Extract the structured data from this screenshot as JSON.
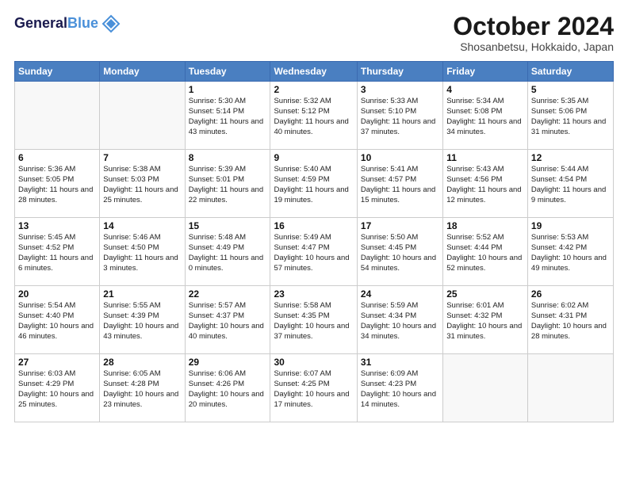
{
  "header": {
    "logo_line1": "General",
    "logo_line2": "Blue",
    "month": "October 2024",
    "location": "Shosanbetsu, Hokkaido, Japan"
  },
  "days_of_week": [
    "Sunday",
    "Monday",
    "Tuesday",
    "Wednesday",
    "Thursday",
    "Friday",
    "Saturday"
  ],
  "weeks": [
    [
      {
        "day": "",
        "info": ""
      },
      {
        "day": "",
        "info": ""
      },
      {
        "day": "1",
        "info": "Sunrise: 5:30 AM\nSunset: 5:14 PM\nDaylight: 11 hours and 43 minutes."
      },
      {
        "day": "2",
        "info": "Sunrise: 5:32 AM\nSunset: 5:12 PM\nDaylight: 11 hours and 40 minutes."
      },
      {
        "day": "3",
        "info": "Sunrise: 5:33 AM\nSunset: 5:10 PM\nDaylight: 11 hours and 37 minutes."
      },
      {
        "day": "4",
        "info": "Sunrise: 5:34 AM\nSunset: 5:08 PM\nDaylight: 11 hours and 34 minutes."
      },
      {
        "day": "5",
        "info": "Sunrise: 5:35 AM\nSunset: 5:06 PM\nDaylight: 11 hours and 31 minutes."
      }
    ],
    [
      {
        "day": "6",
        "info": "Sunrise: 5:36 AM\nSunset: 5:05 PM\nDaylight: 11 hours and 28 minutes."
      },
      {
        "day": "7",
        "info": "Sunrise: 5:38 AM\nSunset: 5:03 PM\nDaylight: 11 hours and 25 minutes."
      },
      {
        "day": "8",
        "info": "Sunrise: 5:39 AM\nSunset: 5:01 PM\nDaylight: 11 hours and 22 minutes."
      },
      {
        "day": "9",
        "info": "Sunrise: 5:40 AM\nSunset: 4:59 PM\nDaylight: 11 hours and 19 minutes."
      },
      {
        "day": "10",
        "info": "Sunrise: 5:41 AM\nSunset: 4:57 PM\nDaylight: 11 hours and 15 minutes."
      },
      {
        "day": "11",
        "info": "Sunrise: 5:43 AM\nSunset: 4:56 PM\nDaylight: 11 hours and 12 minutes."
      },
      {
        "day": "12",
        "info": "Sunrise: 5:44 AM\nSunset: 4:54 PM\nDaylight: 11 hours and 9 minutes."
      }
    ],
    [
      {
        "day": "13",
        "info": "Sunrise: 5:45 AM\nSunset: 4:52 PM\nDaylight: 11 hours and 6 minutes."
      },
      {
        "day": "14",
        "info": "Sunrise: 5:46 AM\nSunset: 4:50 PM\nDaylight: 11 hours and 3 minutes."
      },
      {
        "day": "15",
        "info": "Sunrise: 5:48 AM\nSunset: 4:49 PM\nDaylight: 11 hours and 0 minutes."
      },
      {
        "day": "16",
        "info": "Sunrise: 5:49 AM\nSunset: 4:47 PM\nDaylight: 10 hours and 57 minutes."
      },
      {
        "day": "17",
        "info": "Sunrise: 5:50 AM\nSunset: 4:45 PM\nDaylight: 10 hours and 54 minutes."
      },
      {
        "day": "18",
        "info": "Sunrise: 5:52 AM\nSunset: 4:44 PM\nDaylight: 10 hours and 52 minutes."
      },
      {
        "day": "19",
        "info": "Sunrise: 5:53 AM\nSunset: 4:42 PM\nDaylight: 10 hours and 49 minutes."
      }
    ],
    [
      {
        "day": "20",
        "info": "Sunrise: 5:54 AM\nSunset: 4:40 PM\nDaylight: 10 hours and 46 minutes."
      },
      {
        "day": "21",
        "info": "Sunrise: 5:55 AM\nSunset: 4:39 PM\nDaylight: 10 hours and 43 minutes."
      },
      {
        "day": "22",
        "info": "Sunrise: 5:57 AM\nSunset: 4:37 PM\nDaylight: 10 hours and 40 minutes."
      },
      {
        "day": "23",
        "info": "Sunrise: 5:58 AM\nSunset: 4:35 PM\nDaylight: 10 hours and 37 minutes."
      },
      {
        "day": "24",
        "info": "Sunrise: 5:59 AM\nSunset: 4:34 PM\nDaylight: 10 hours and 34 minutes."
      },
      {
        "day": "25",
        "info": "Sunrise: 6:01 AM\nSunset: 4:32 PM\nDaylight: 10 hours and 31 minutes."
      },
      {
        "day": "26",
        "info": "Sunrise: 6:02 AM\nSunset: 4:31 PM\nDaylight: 10 hours and 28 minutes."
      }
    ],
    [
      {
        "day": "27",
        "info": "Sunrise: 6:03 AM\nSunset: 4:29 PM\nDaylight: 10 hours and 25 minutes."
      },
      {
        "day": "28",
        "info": "Sunrise: 6:05 AM\nSunset: 4:28 PM\nDaylight: 10 hours and 23 minutes."
      },
      {
        "day": "29",
        "info": "Sunrise: 6:06 AM\nSunset: 4:26 PM\nDaylight: 10 hours and 20 minutes."
      },
      {
        "day": "30",
        "info": "Sunrise: 6:07 AM\nSunset: 4:25 PM\nDaylight: 10 hours and 17 minutes."
      },
      {
        "day": "31",
        "info": "Sunrise: 6:09 AM\nSunset: 4:23 PM\nDaylight: 10 hours and 14 minutes."
      },
      {
        "day": "",
        "info": ""
      },
      {
        "day": "",
        "info": ""
      }
    ]
  ]
}
